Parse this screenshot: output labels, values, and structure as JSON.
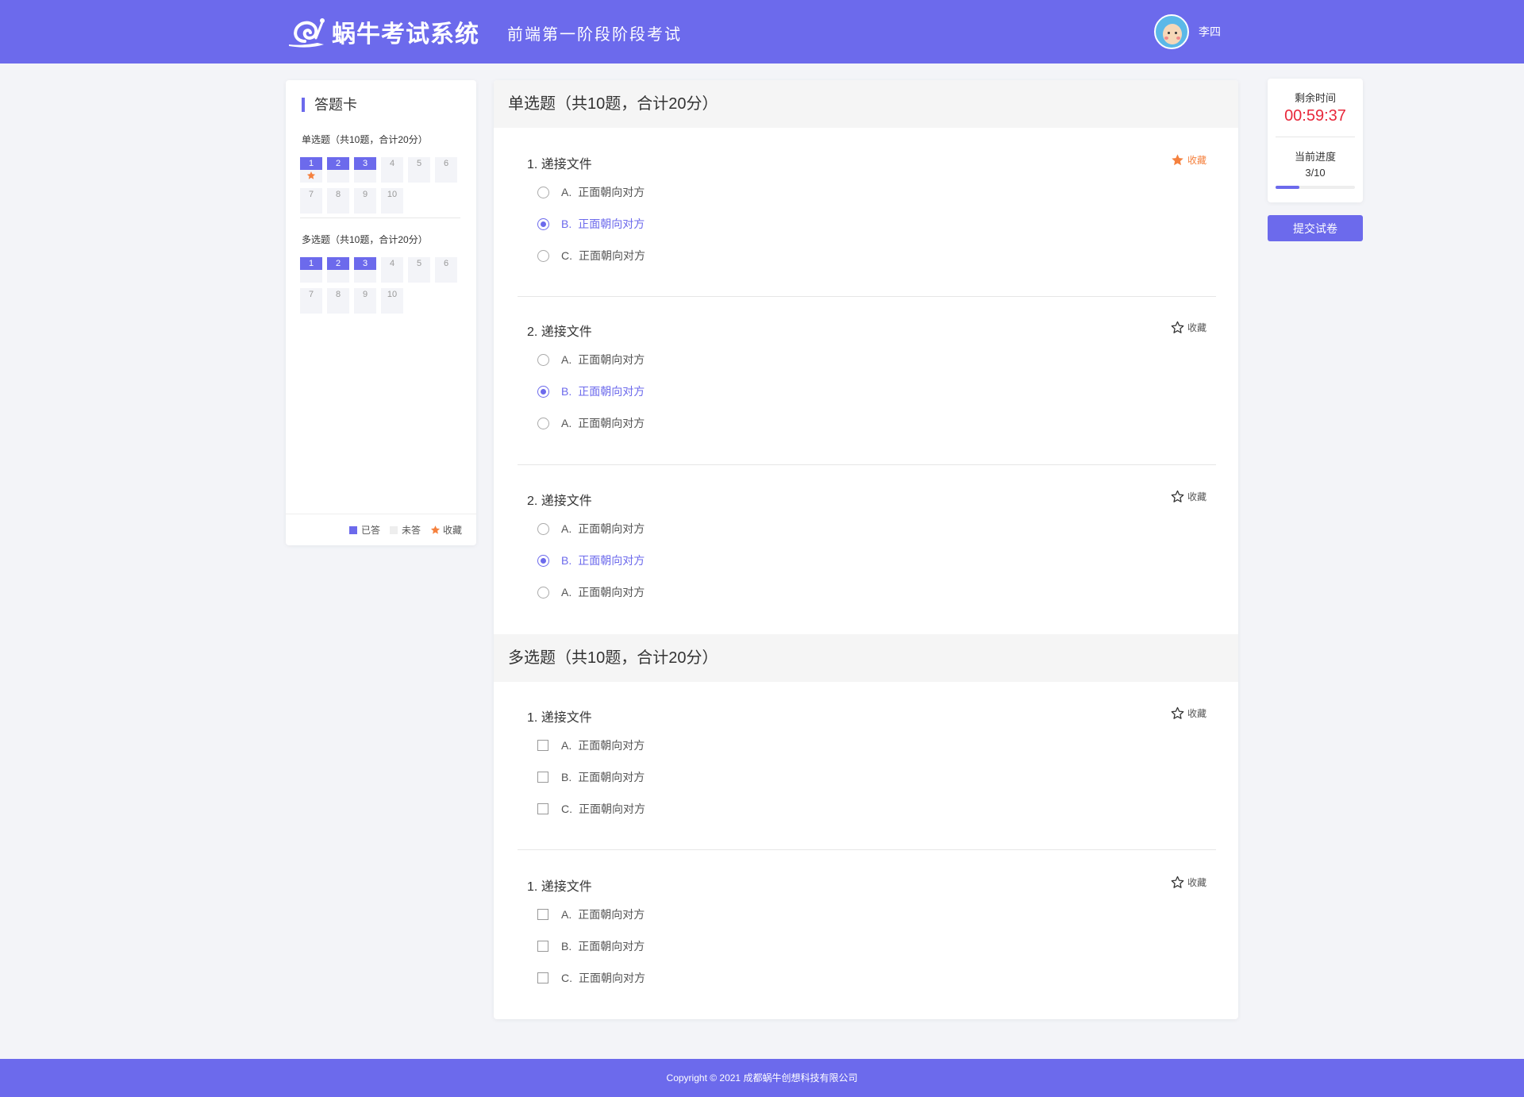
{
  "header": {
    "logo_text": "蜗牛考试系统",
    "exam_title": "前端第一阶段阶段考试",
    "user_name": "李四"
  },
  "answer_card": {
    "title": "答题卡",
    "sections": [
      {
        "title": "单选题（共10题，合计20分）",
        "items": [
          {
            "num": "1",
            "answered": true,
            "favorited": true
          },
          {
            "num": "2",
            "answered": true,
            "favorited": false
          },
          {
            "num": "3",
            "answered": true,
            "favorited": false
          },
          {
            "num": "4",
            "answered": false,
            "favorited": false
          },
          {
            "num": "5",
            "answered": false,
            "favorited": false
          },
          {
            "num": "6",
            "answered": false,
            "favorited": false
          },
          {
            "num": "7",
            "answered": false,
            "favorited": false
          },
          {
            "num": "8",
            "answered": false,
            "favorited": false
          },
          {
            "num": "9",
            "answered": false,
            "favorited": false
          },
          {
            "num": "10",
            "answered": false,
            "favorited": false
          }
        ]
      },
      {
        "title": "多选题（共10题，合计20分）",
        "items": [
          {
            "num": "1",
            "answered": true,
            "favorited": false
          },
          {
            "num": "2",
            "answered": true,
            "favorited": false
          },
          {
            "num": "3",
            "answered": true,
            "favorited": false
          },
          {
            "num": "4",
            "answered": false,
            "favorited": false
          },
          {
            "num": "5",
            "answered": false,
            "favorited": false
          },
          {
            "num": "6",
            "answered": false,
            "favorited": false
          },
          {
            "num": "7",
            "answered": false,
            "favorited": false
          },
          {
            "num": "8",
            "answered": false,
            "favorited": false
          },
          {
            "num": "9",
            "answered": false,
            "favorited": false
          },
          {
            "num": "10",
            "answered": false,
            "favorited": false
          }
        ]
      }
    ],
    "legend": {
      "answered": "已答",
      "unanswered": "未答",
      "favorited": "收藏"
    }
  },
  "main": {
    "single": {
      "title": "单选题（共10题，合计20分）",
      "questions": [
        {
          "title": "1. 递接文件",
          "fav_label": "收藏",
          "favorited": true,
          "options": [
            {
              "key": "A.",
              "text": "正面朝向对方",
              "selected": false
            },
            {
              "key": "B.",
              "text": "正面朝向对方",
              "selected": true
            },
            {
              "key": "C.",
              "text": "正面朝向对方",
              "selected": false
            }
          ]
        },
        {
          "title": "2. 递接文件",
          "fav_label": "收藏",
          "favorited": false,
          "options": [
            {
              "key": "A.",
              "text": "正面朝向对方",
              "selected": false
            },
            {
              "key": "B.",
              "text": "正面朝向对方",
              "selected": true
            },
            {
              "key": "A.",
              "text": "正面朝向对方",
              "selected": false
            }
          ]
        },
        {
          "title": "2. 递接文件",
          "fav_label": "收藏",
          "favorited": false,
          "options": [
            {
              "key": "A.",
              "text": "正面朝向对方",
              "selected": false
            },
            {
              "key": "B.",
              "text": "正面朝向对方",
              "selected": true
            },
            {
              "key": "A.",
              "text": "正面朝向对方",
              "selected": false
            }
          ]
        }
      ]
    },
    "multi": {
      "title": "多选题（共10题，合计20分）",
      "questions": [
        {
          "title": "1. 递接文件",
          "fav_label": "收藏",
          "favorited": false,
          "options": [
            {
              "key": "A.",
              "text": "正面朝向对方",
              "selected": false
            },
            {
              "key": "B.",
              "text": "正面朝向对方",
              "selected": false
            },
            {
              "key": "C.",
              "text": "正面朝向对方",
              "selected": false
            }
          ]
        },
        {
          "title": "1. 递接文件",
          "fav_label": "收藏",
          "favorited": false,
          "options": [
            {
              "key": "A.",
              "text": "正面朝向对方",
              "selected": false
            },
            {
              "key": "B.",
              "text": "正面朝向对方",
              "selected": false
            },
            {
              "key": "C.",
              "text": "正面朝向对方",
              "selected": false
            }
          ]
        }
      ]
    }
  },
  "status": {
    "time_label": "剩余时间",
    "time_value": "00:59:37",
    "progress_label": "当前进度",
    "progress_text": "3/10",
    "progress_fraction": 0.3
  },
  "submit_label": "提交试卷",
  "footer": "Copyright © 2021  成都蜗牛创想科技有限公司",
  "colors": {
    "accent": "#6c6aec",
    "favorite": "#f5813e",
    "timer": "#e8283b"
  }
}
